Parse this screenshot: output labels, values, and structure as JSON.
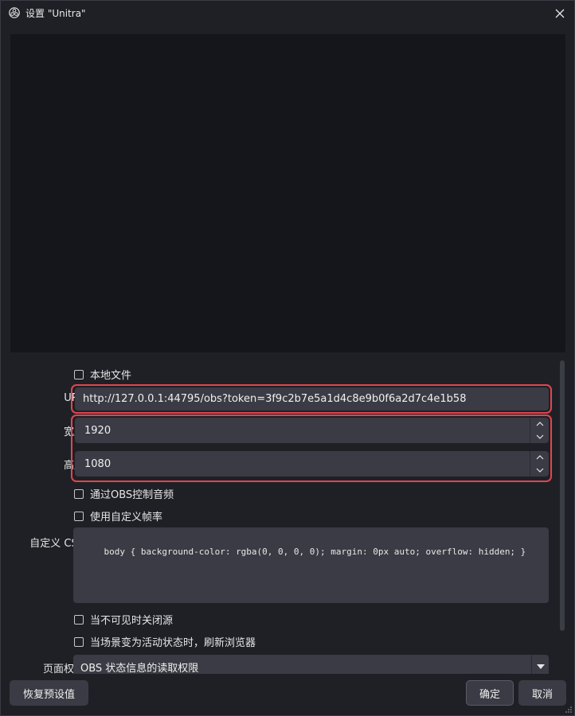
{
  "window": {
    "title": "设置 \"Unitra\""
  },
  "form": {
    "local_file_label": "本地文件",
    "url_label": "URL",
    "url_value": "http://127.0.0.1:44795/obs?token=3f9c2b7e5a1d4c8e9b0f6a2d7c4e1b58",
    "width_label": "宽度",
    "width_value": "1920",
    "height_label": "高度",
    "height_value": "1080",
    "control_audio_label": "通过OBS控制音频",
    "custom_fps_label": "使用自定义帧率",
    "custom_css_label": "自定义 CSS",
    "custom_css_value": "body { background-color: rgba(0, 0, 0, 0); margin: 0px auto; overflow: hidden; }",
    "shutdown_hidden_label": "当不可见时关闭源",
    "refresh_active_label": "当场景变为活动状态时，刷新浏览器",
    "page_permissions_label": "页面权限",
    "page_permissions_value": "OBS 状态信息的读取权限"
  },
  "footer": {
    "restore_defaults_label": "恢复预设值",
    "ok_label": "确定",
    "cancel_label": "取消"
  },
  "colors": {
    "highlight": "#e0464e",
    "field_bg": "#3a3b44",
    "window_bg": "#1f2026",
    "preview_bg": "#15161b"
  }
}
